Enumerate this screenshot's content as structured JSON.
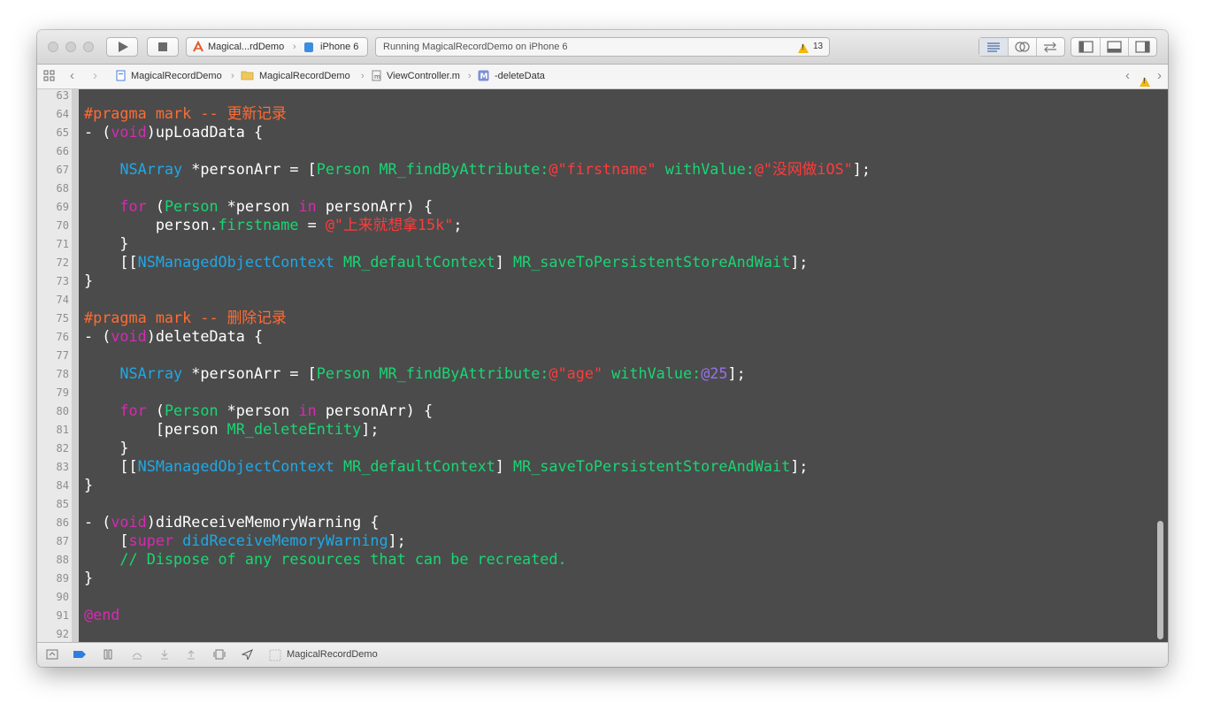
{
  "toolbar": {
    "run_label": "Run",
    "stop_label": "Stop",
    "scheme_target": "Magical...rdDemo",
    "scheme_device": "iPhone 6",
    "status_text": "Running MagicalRecordDemo on iPhone 6",
    "warning_count": "13"
  },
  "jumpbar": {
    "crumbs": [
      "MagicalRecordDemo",
      "MagicalRecordDemo",
      "ViewController.m",
      "-deleteData"
    ]
  },
  "editor": {
    "line_numbers": [
      "63",
      "64",
      "65",
      "66",
      "67",
      "68",
      "69",
      "70",
      "71",
      "72",
      "73",
      "74",
      "75",
      "76",
      "77",
      "78",
      "79",
      "80",
      "81",
      "82",
      "83",
      "84",
      "85",
      "86",
      "87",
      "88",
      "89",
      "90",
      "91",
      "92"
    ],
    "lines": [
      [],
      [
        {
          "t": "#pragma mark -- 更新记录",
          "c": "m"
        }
      ],
      [
        {
          "t": "- (",
          "c": "w"
        },
        {
          "t": "void",
          "c": "k"
        },
        {
          "t": ")upLoadData {",
          "c": "w"
        }
      ],
      [],
      [
        {
          "t": "    ",
          "c": "w"
        },
        {
          "t": "NSArray",
          "c": "t"
        },
        {
          "t": " *personArr = [",
          "c": "w"
        },
        {
          "t": "Person",
          "c": "c"
        },
        {
          "t": " ",
          "c": "w"
        },
        {
          "t": "MR_findByAttribute:",
          "c": "c"
        },
        {
          "t": "@\"firstname\"",
          "c": "s"
        },
        {
          "t": " ",
          "c": "w"
        },
        {
          "t": "withValue:",
          "c": "c"
        },
        {
          "t": "@\"没网做iOS\"",
          "c": "s"
        },
        {
          "t": "];",
          "c": "w"
        }
      ],
      [],
      [
        {
          "t": "    ",
          "c": "w"
        },
        {
          "t": "for",
          "c": "k"
        },
        {
          "t": " (",
          "c": "w"
        },
        {
          "t": "Person",
          "c": "c"
        },
        {
          "t": " *person ",
          "c": "w"
        },
        {
          "t": "in",
          "c": "k"
        },
        {
          "t": " personArr) {",
          "c": "w"
        }
      ],
      [
        {
          "t": "        person.",
          "c": "w"
        },
        {
          "t": "firstname",
          "c": "c"
        },
        {
          "t": " = ",
          "c": "w"
        },
        {
          "t": "@\"上来就想拿15k\"",
          "c": "s"
        },
        {
          "t": ";",
          "c": "w"
        }
      ],
      [
        {
          "t": "    }",
          "c": "w"
        }
      ],
      [
        {
          "t": "    [[",
          "c": "w"
        },
        {
          "t": "NSManagedObjectContext",
          "c": "t"
        },
        {
          "t": " ",
          "c": "w"
        },
        {
          "t": "MR_defaultContext",
          "c": "c"
        },
        {
          "t": "] ",
          "c": "w"
        },
        {
          "t": "MR_saveToPersistentStoreAndWait",
          "c": "c"
        },
        {
          "t": "];",
          "c": "w"
        }
      ],
      [
        {
          "t": "}",
          "c": "w"
        }
      ],
      [],
      [
        {
          "t": "#pragma mark -- 删除记录",
          "c": "m"
        }
      ],
      [
        {
          "t": "- (",
          "c": "w"
        },
        {
          "t": "void",
          "c": "k"
        },
        {
          "t": ")deleteData {",
          "c": "w"
        }
      ],
      [],
      [
        {
          "t": "    ",
          "c": "w"
        },
        {
          "t": "NSArray",
          "c": "t"
        },
        {
          "t": " *personArr = [",
          "c": "w"
        },
        {
          "t": "Person",
          "c": "c"
        },
        {
          "t": " ",
          "c": "w"
        },
        {
          "t": "MR_findByAttribute:",
          "c": "c"
        },
        {
          "t": "@\"age\"",
          "c": "s"
        },
        {
          "t": " ",
          "c": "w"
        },
        {
          "t": "withValue:",
          "c": "c"
        },
        {
          "t": "@25",
          "c": "n"
        },
        {
          "t": "];",
          "c": "w"
        }
      ],
      [],
      [
        {
          "t": "    ",
          "c": "w"
        },
        {
          "t": "for",
          "c": "k"
        },
        {
          "t": " (",
          "c": "w"
        },
        {
          "t": "Person",
          "c": "c"
        },
        {
          "t": " *person ",
          "c": "w"
        },
        {
          "t": "in",
          "c": "k"
        },
        {
          "t": " personArr) {",
          "c": "w"
        }
      ],
      [
        {
          "t": "        [person ",
          "c": "w"
        },
        {
          "t": "MR_deleteEntity",
          "c": "c"
        },
        {
          "t": "];",
          "c": "w"
        }
      ],
      [
        {
          "t": "    }",
          "c": "w"
        }
      ],
      [
        {
          "t": "    [[",
          "c": "w"
        },
        {
          "t": "NSManagedObjectContext",
          "c": "t"
        },
        {
          "t": " ",
          "c": "w"
        },
        {
          "t": "MR_defaultContext",
          "c": "c"
        },
        {
          "t": "] ",
          "c": "w"
        },
        {
          "t": "MR_saveToPersistentStoreAndWait",
          "c": "c"
        },
        {
          "t": "];",
          "c": "w"
        }
      ],
      [
        {
          "t": "}",
          "c": "w"
        }
      ],
      [],
      [
        {
          "t": "- (",
          "c": "w"
        },
        {
          "t": "void",
          "c": "k"
        },
        {
          "t": ")didReceiveMemoryWarning {",
          "c": "w"
        }
      ],
      [
        {
          "t": "    [",
          "c": "w"
        },
        {
          "t": "super",
          "c": "k"
        },
        {
          "t": " ",
          "c": "w"
        },
        {
          "t": "didReceiveMemoryWarning",
          "c": "t"
        },
        {
          "t": "];",
          "c": "w"
        }
      ],
      [
        {
          "t": "    // Dispose of any resources that can be recreated.",
          "c": "c"
        }
      ],
      [
        {
          "t": "}",
          "c": "w"
        }
      ],
      [],
      [
        {
          "t": "@end",
          "c": "k"
        }
      ],
      []
    ]
  },
  "debugbar": {
    "target_label": "MagicalRecordDemo"
  },
  "colors": {
    "editor_bg": "#4b4b4b",
    "keyword": "#d62bb0",
    "type": "#1fa8e6",
    "method": "#18d673",
    "macro": "#ff6b33",
    "string": "#ff3b3b",
    "number": "#9a71e8",
    "warning": "#f2b80e"
  },
  "icons": [
    "play-icon",
    "stop-icon",
    "xcode-project-icon",
    "iphone-icon",
    "warning-icon",
    "navigator-icon",
    "debug-area-icon",
    "utilities-icon",
    "grid-icon",
    "file-icon",
    "folder-icon",
    "method-icon"
  ]
}
